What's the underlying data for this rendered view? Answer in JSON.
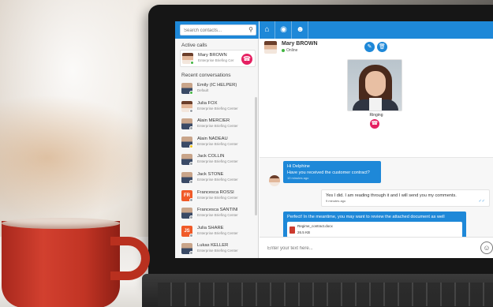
{
  "search": {
    "placeholder": "Search contacts..."
  },
  "sidebar": {
    "active_calls_title": "Active calls",
    "active_call": {
      "name": "Mary BROWN",
      "company": "Enterprise Briefing Cer"
    },
    "recent_title": "Recent conversations",
    "recent": [
      {
        "name": "Emily (IC HELPER)",
        "company": "Default",
        "presence": "online",
        "avatar": "photo"
      },
      {
        "name": "Julia FOX",
        "company": "Enterprise Briefing Center",
        "presence": "offline",
        "avatar": "photo-female"
      },
      {
        "name": "Alain MERCIER",
        "company": "Enterprise Briefing Center",
        "presence": "offline",
        "avatar": "photo"
      },
      {
        "name": "Alain NADEAU",
        "company": "Enterprise Briefing Center",
        "presence": "away",
        "avatar": "photo"
      },
      {
        "name": "Jack COLLIN",
        "company": "Enterprise Briefing Center",
        "presence": "offline",
        "avatar": "photo"
      },
      {
        "name": "Jack STONE",
        "company": "Enterprise Briefing Center",
        "presence": "offline",
        "avatar": "photo"
      },
      {
        "name": "Francesca ROSSI",
        "company": "Enterprise Briefing Center",
        "presence": "offline",
        "avatar": "initials",
        "initials": "FR",
        "color": "#f05a28"
      },
      {
        "name": "Francesca SANTINI",
        "company": "Enterprise Briefing Center",
        "presence": "offline",
        "avatar": "photo"
      },
      {
        "name": "Julia SHARE",
        "company": "Enterprise Briefing Center",
        "presence": "offline",
        "avatar": "initials",
        "initials": "JS",
        "color": "#f05a28"
      },
      {
        "name": "Lukas KELLER",
        "company": "Enterprise Briefing Center",
        "presence": "offline",
        "avatar": "photo"
      }
    ]
  },
  "toolbar": {
    "icons": [
      "home-icon",
      "globe-icon",
      "user-icon"
    ]
  },
  "conversation": {
    "contact_name": "Mary BROWN",
    "contact_status": "Online",
    "call_status": "Ringing",
    "messages": [
      {
        "direction": "in",
        "lines": [
          "Hi Delphine",
          "Have you received the customer contract?"
        ],
        "time": "10 minutes ago"
      },
      {
        "direction": "out",
        "lines": [
          "Yes I did. I am reading through it and I will send you my comments."
        ],
        "time": "9 minutes ago"
      },
      {
        "direction": "in",
        "lines": [
          "Perfect! In the meantime, you may want to review the attached document as well"
        ],
        "attachment": {
          "name": "Regime_contract.docx",
          "size": "26.5 KB"
        }
      }
    ]
  },
  "composer": {
    "placeholder": "Enter your text here..."
  },
  "colors": {
    "accent": "#1e88d8",
    "hangup": "#e51f61",
    "online": "#42b541",
    "away": "#f0c419"
  }
}
